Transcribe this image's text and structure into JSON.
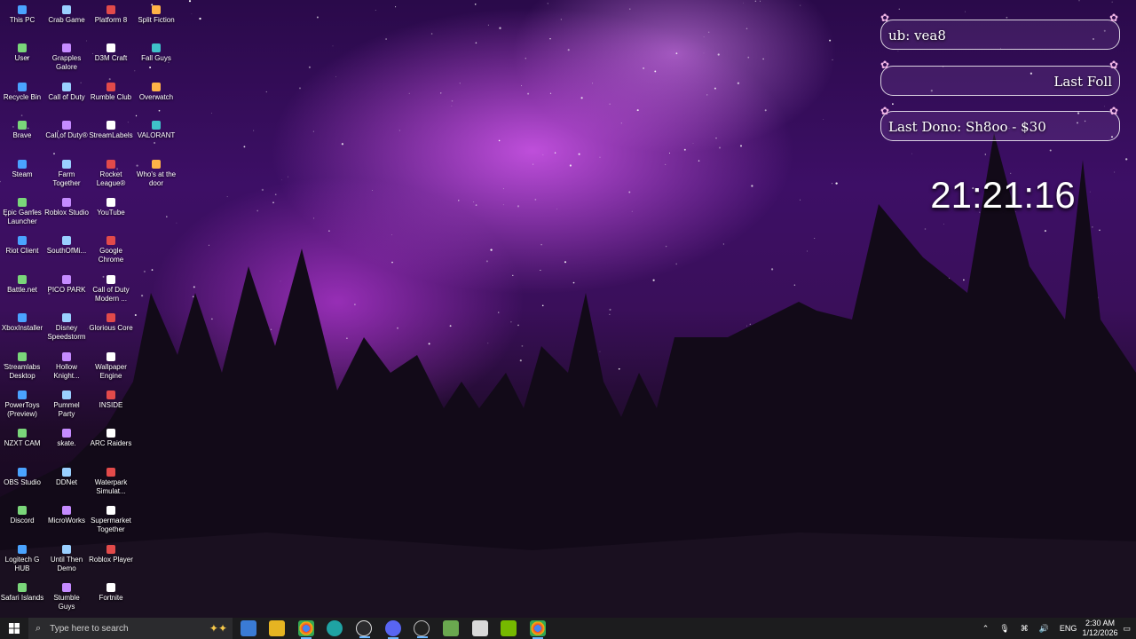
{
  "desktop_icons": [
    [
      "This PC",
      "Crab Game",
      "Platform 8",
      "Split Fiction"
    ],
    [
      "User",
      "Grapples Galore",
      "D3M Craft",
      "Fall Guys"
    ],
    [
      "Recycle Bin",
      "Call of Duty",
      "Rumble Club",
      "Overwatch"
    ],
    [
      "Brave",
      "Call of Duty®",
      "StreamLabels",
      "VALORANT"
    ],
    [
      "Steam",
      "Farm Together",
      "Rocket League®",
      "Who's at the door"
    ],
    [
      "Epic Games Launcher",
      "Roblox Studio",
      "YouTube",
      ""
    ],
    [
      "Riot Client",
      "SouthOfMi...",
      "Google Chrome",
      ""
    ],
    [
      "Battle.net",
      "PICO PARK",
      "Call of Duty Modern ...",
      ""
    ],
    [
      "XboxInstaller",
      "Disney Speedstorm",
      "Glorious Core",
      ""
    ],
    [
      "Streamlabs Desktop",
      "Hollow Knight...",
      "Wallpaper Engine",
      ""
    ],
    [
      "PowerToys (Preview)",
      "Pummel Party",
      "INSIDE",
      ""
    ],
    [
      "NZXT CAM",
      "skate.",
      "ARC Raiders",
      ""
    ],
    [
      "OBS Studio",
      "DDNet",
      "Waterpark Simulat...",
      ""
    ],
    [
      "Discord",
      "MicroWorks",
      "Supermarket Together",
      ""
    ],
    [
      "Logitech G HUB",
      "Until Then Demo",
      "Roblox Player",
      ""
    ],
    [
      "Safari Islands",
      "Stumble Guys",
      "Fortnite",
      ""
    ]
  ],
  "icon_colors": [
    "#4aa3ff",
    "#9ad0ff",
    "#e24a4a",
    "#ffb347",
    "#7ad67a",
    "#c58bff",
    "#ffffff",
    "#3fc1c9"
  ],
  "overlay": {
    "sub": "ub: vea8",
    "follow": "Last Foll",
    "dono": "Last Dono: Sh8oo - $30"
  },
  "clock": "21:21:16",
  "taskbar": {
    "search_placeholder": "Type here to search",
    "language": "ENG",
    "time": "2:30 AM",
    "date": "1/12/2026"
  }
}
